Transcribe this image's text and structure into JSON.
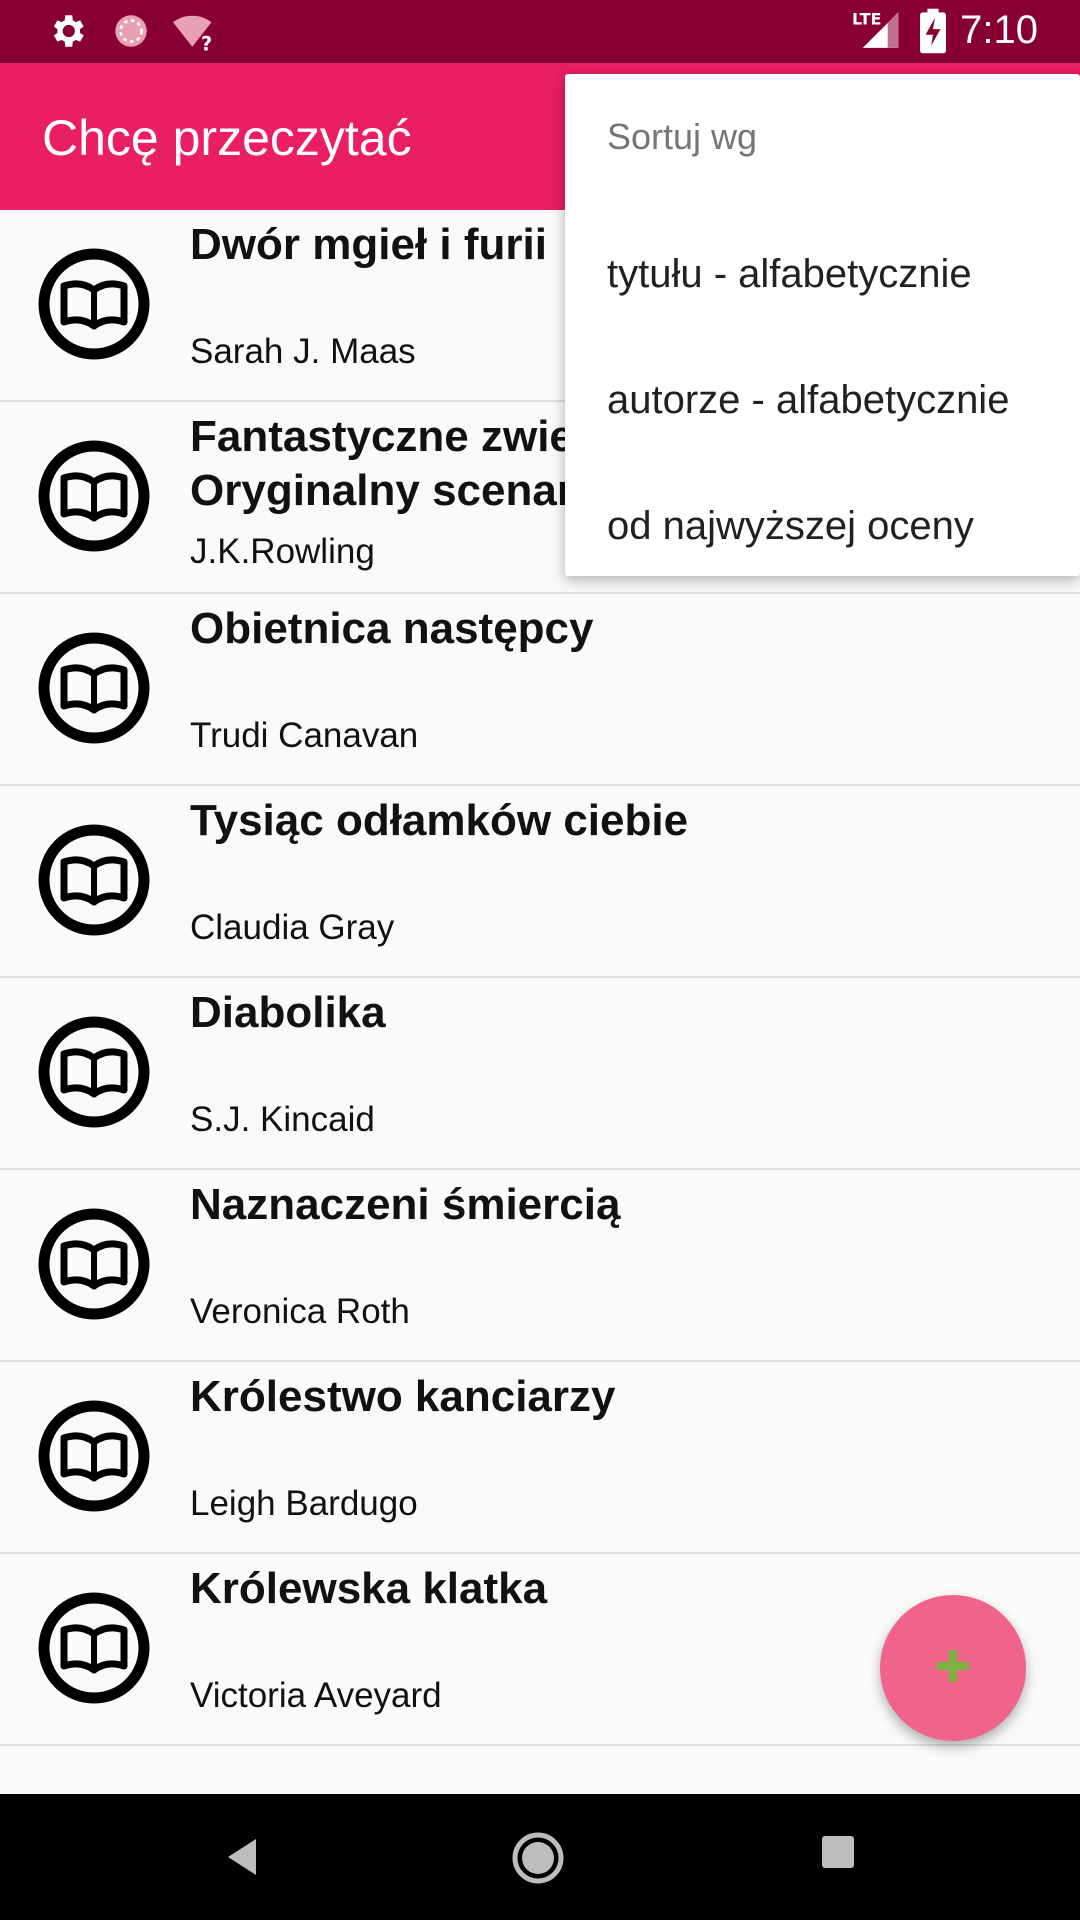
{
  "status_bar": {
    "time": "7:10",
    "network": "LTE",
    "icons": [
      "settings-icon",
      "sync-icon",
      "wifi-unknown-icon",
      "signal-icon",
      "battery-charging-icon"
    ]
  },
  "app_bar": {
    "title": "Chcę przeczytać"
  },
  "sort_menu": {
    "header": "Sortuj wg",
    "items": [
      {
        "label": "tytułu - alfabetycznie"
      },
      {
        "label": "autorze - alfabetycznie"
      },
      {
        "label": "od najwyższej oceny"
      }
    ]
  },
  "books": [
    {
      "title": "Dwór mgieł i furii",
      "author": "Sarah J. Maas"
    },
    {
      "title": "Fantastyczne zwie\nOryginalny scenar",
      "author": "J.K.Rowling"
    },
    {
      "title": "Obietnica następcy",
      "author": "Trudi Canavan"
    },
    {
      "title": "Tysiąc odłamków ciebie",
      "author": "Claudia Gray"
    },
    {
      "title": "Diabolika",
      "author": "S.J. Kincaid"
    },
    {
      "title": "Naznaczeni śmiercią",
      "author": "Veronica Roth"
    },
    {
      "title": "Królestwo kanciarzy",
      "author": "Leigh Bardugo"
    },
    {
      "title": "Królewska klatka",
      "author": "Victoria Aveyard"
    }
  ],
  "fab": {
    "icon": "plus-icon",
    "color": "#7cb342"
  },
  "colors": {
    "status_bar": "#880033",
    "app_bar": "#e91e63",
    "fab": "#f0648c"
  }
}
